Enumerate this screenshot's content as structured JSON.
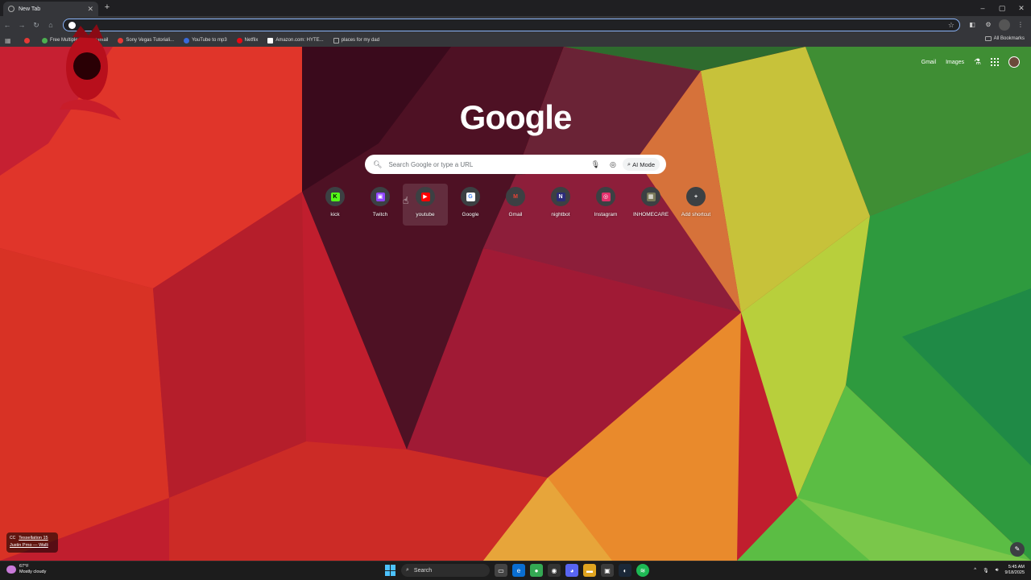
{
  "browser": {
    "tab": {
      "title": "New Tab",
      "close": "✕"
    },
    "new_tab_symbol": "+",
    "window_controls": [
      "–",
      "▢",
      "✕"
    ],
    "address_bar": {
      "value": "",
      "placeholder": ""
    },
    "bookmarks": [
      {
        "label": "Free Multiple",
        "color": "#4caf50"
      },
      {
        "label": "Gmail",
        "color": "#ea4335"
      },
      {
        "label": "Sony Vegas Tutoriali...",
        "color": "#e53935"
      },
      {
        "label": "YouTube to mp3",
        "color": "#3a6ad8"
      },
      {
        "label": "Netflix",
        "color": "#e50914"
      },
      {
        "label": "Amazon.com: HYTE...",
        "color": "#ffffff"
      },
      {
        "label": "places for my dad",
        "color": "folder"
      }
    ],
    "all_bookmarks": "All Bookmarks"
  },
  "newtab": {
    "top_links": {
      "gmail": "Gmail",
      "images": "Images"
    },
    "logo": "Google",
    "search": {
      "placeholder": "Search Google or type a URL",
      "ai_mode": "AI Mode"
    },
    "shortcuts": [
      {
        "label": "kick",
        "letter": "K",
        "bg": "#53fc18",
        "fg": "#000000"
      },
      {
        "label": "Twitch",
        "letter": "▣",
        "bg": "#9146ff",
        "fg": "#ffffff"
      },
      {
        "label": "youtube",
        "letter": "▶",
        "bg": "#ff0000",
        "fg": "#ffffff"
      },
      {
        "label": "Google",
        "letter": "G",
        "bg": "#ffffff",
        "fg": "#4285f4"
      },
      {
        "label": "Gmail",
        "letter": "M",
        "bg": "#3c4043",
        "fg": "#ea4335"
      },
      {
        "label": "nightbot",
        "letter": "N",
        "bg": "#2b2b7a",
        "fg": "#ffffff"
      },
      {
        "label": "Instagram",
        "letter": "◎",
        "bg": "#e1306c",
        "fg": "#ffffff"
      },
      {
        "label": "INHOMECARE",
        "letter": "▦",
        "bg": "#7a7a5a",
        "fg": "#ffffff"
      },
      {
        "label": "Add shortcut",
        "letter": "+",
        "bg": "#3c4043",
        "fg": "#ffffff"
      }
    ],
    "background_credit": {
      "title": "Tessellation 15",
      "author": "Justin Prno — Walli"
    }
  },
  "taskbar": {
    "weather": {
      "temp": "67°F",
      "condition": "Mostly cloudy"
    },
    "search_label": "Search",
    "clock": {
      "time": "5:45 AM",
      "date": "9/18/2025"
    }
  },
  "colors": {
    "accent": "#8ab4f8",
    "start_blue": "#4cc2ff"
  }
}
